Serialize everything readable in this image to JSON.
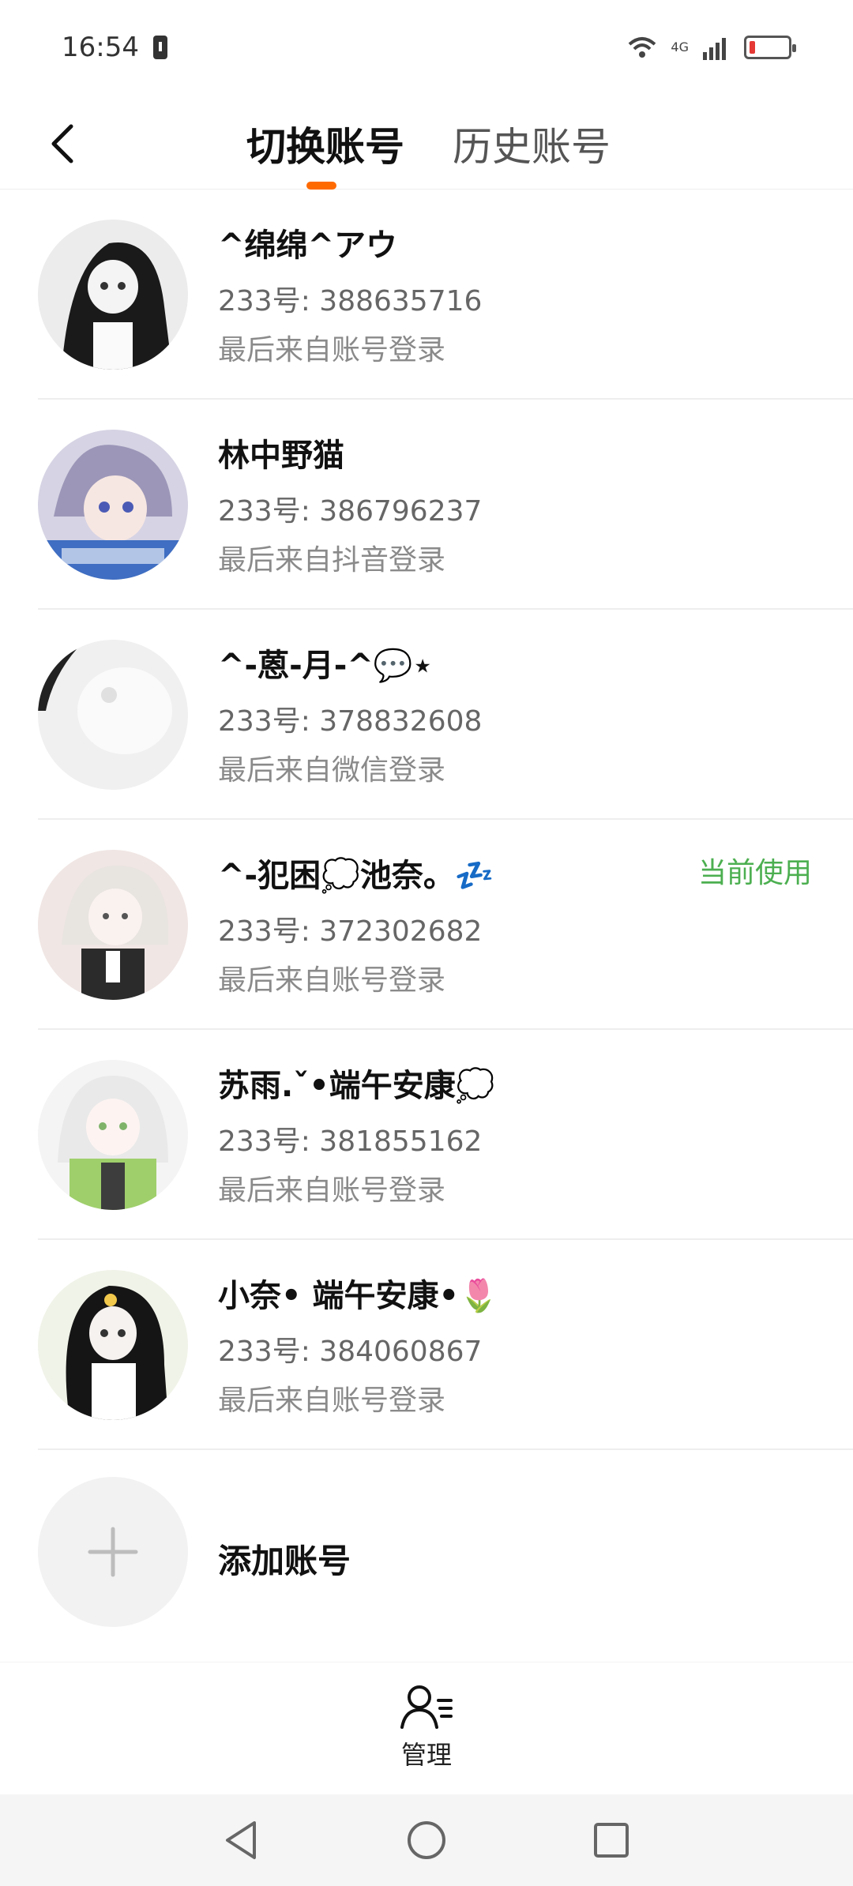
{
  "status_bar": {
    "time": "16:54",
    "network": "4G"
  },
  "header": {
    "tabs": [
      {
        "label": "切换账号",
        "active": true
      },
      {
        "label": "历史账号",
        "active": false
      }
    ],
    "accent_color": "#ff6a00"
  },
  "accounts": [
    {
      "name": "^绵绵^アウ",
      "uid": "233号: 388635716",
      "login": "最后来自账号登录",
      "current": false
    },
    {
      "name": "林中野猫",
      "uid": "233号: 386796237",
      "login": "最后来自抖音登录",
      "current": false
    },
    {
      "name": "^-蒽-月-^💬⋆",
      "uid": "233号: 378832608",
      "login": "最后来自微信登录",
      "current": false
    },
    {
      "name": "^-犯困💭池奈。💤",
      "uid": "233号: 372302682",
      "login": "最后来自账号登录",
      "current": true,
      "current_label": "当前使用"
    },
    {
      "name": "苏雨.ˇ•端午安康💭",
      "uid": "233号: 381855162",
      "login": "最后来自账号登录",
      "current": false
    },
    {
      "name": "小奈• 端午安康•🌷",
      "uid": "233号: 384060867",
      "login": "最后来自账号登录",
      "current": false
    }
  ],
  "add_account": {
    "label": "添加账号"
  },
  "bottom_bar": {
    "manage_label": "管理"
  },
  "colors": {
    "current_tag": "#4caf50",
    "divider": "#eeeeee"
  }
}
